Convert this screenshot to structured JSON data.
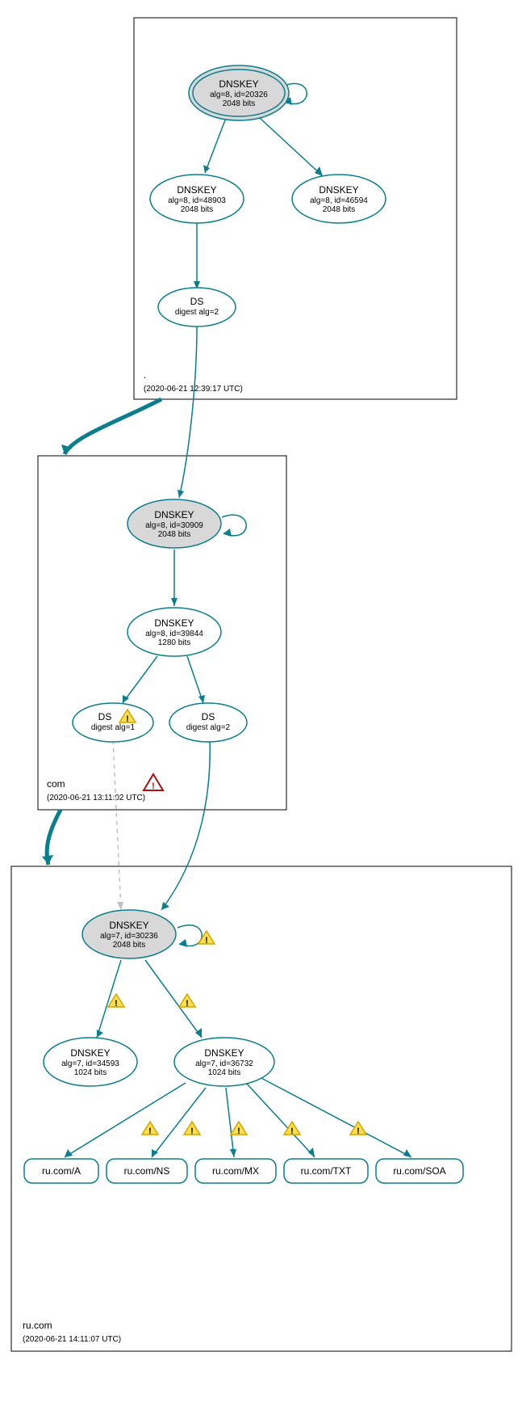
{
  "zones": {
    "root": {
      "label": ".",
      "timestamp": "(2020-06-21 12:39:17 UTC)"
    },
    "com": {
      "label": "com",
      "timestamp": "(2020-06-21 13:11:02 UTC)"
    },
    "rucom": {
      "label": "ru.com",
      "timestamp": "(2020-06-21 14:11:07 UTC)"
    }
  },
  "nodes": {
    "root_ksk": {
      "title": "DNSKEY",
      "l1": "alg=8, id=20326",
      "l2": "2048 bits"
    },
    "root_zsk1": {
      "title": "DNSKEY",
      "l1": "alg=8, id=48903",
      "l2": "2048 bits"
    },
    "root_zsk2": {
      "title": "DNSKEY",
      "l1": "alg=8, id=46594",
      "l2": "2048 bits"
    },
    "root_ds": {
      "title": "DS",
      "l1": "digest alg=2"
    },
    "com_ksk": {
      "title": "DNSKEY",
      "l1": "alg=8, id=30909",
      "l2": "2048 bits"
    },
    "com_zsk": {
      "title": "DNSKEY",
      "l1": "alg=8, id=39844",
      "l2": "1280 bits"
    },
    "com_ds1": {
      "title": "DS",
      "l1": "digest alg=1"
    },
    "com_ds2": {
      "title": "DS",
      "l1": "digest alg=2"
    },
    "ru_ksk": {
      "title": "DNSKEY",
      "l1": "alg=7, id=30236",
      "l2": "2048 bits"
    },
    "ru_zsk1": {
      "title": "DNSKEY",
      "l1": "alg=7, id=34593",
      "l2": "1024 bits"
    },
    "ru_zsk2": {
      "title": "DNSKEY",
      "l1": "alg=7, id=36732",
      "l2": "1024 bits"
    },
    "rr_a": {
      "label": "ru.com/A"
    },
    "rr_ns": {
      "label": "ru.com/NS"
    },
    "rr_mx": {
      "label": "ru.com/MX"
    },
    "rr_txt": {
      "label": "ru.com/TXT"
    },
    "rr_soa": {
      "label": "ru.com/SOA"
    }
  }
}
